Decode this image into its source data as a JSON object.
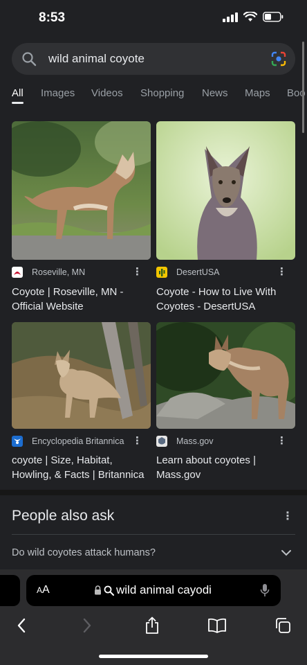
{
  "status": {
    "time": "8:53"
  },
  "search": {
    "query": "wild animal coyote"
  },
  "tabs": [
    "All",
    "Images",
    "Videos",
    "Shopping",
    "News",
    "Maps",
    "Boo"
  ],
  "results": [
    {
      "source": "Roseville, MN",
      "title_line1": "Coyote | Roseville, MN -",
      "title_line2": "Official Website"
    },
    {
      "source": "DesertUSA",
      "title_line1": "Coyote - How to Live With",
      "title_line2": "Coyotes - DesertUSA"
    },
    {
      "source": "Encyclopedia Britannica",
      "title_line1": "coyote | Size, Habitat,",
      "title_line2": "Howling, & Facts | Britannica"
    },
    {
      "source": "Mass.gov",
      "title_line1": "Learn about coyotes |",
      "title_line2": "Mass.gov"
    }
  ],
  "people_also_ask": {
    "heading": "People also ask",
    "questions": [
      "Do wild coyotes attack humans?"
    ]
  },
  "browser": {
    "aa_small": "A",
    "aa_large": "A",
    "address_text": "wild animal cayodi"
  },
  "colors": {
    "background": "#202124",
    "search_box": "#303134",
    "text": "#e8eaed",
    "muted": "#9aa0a6"
  }
}
